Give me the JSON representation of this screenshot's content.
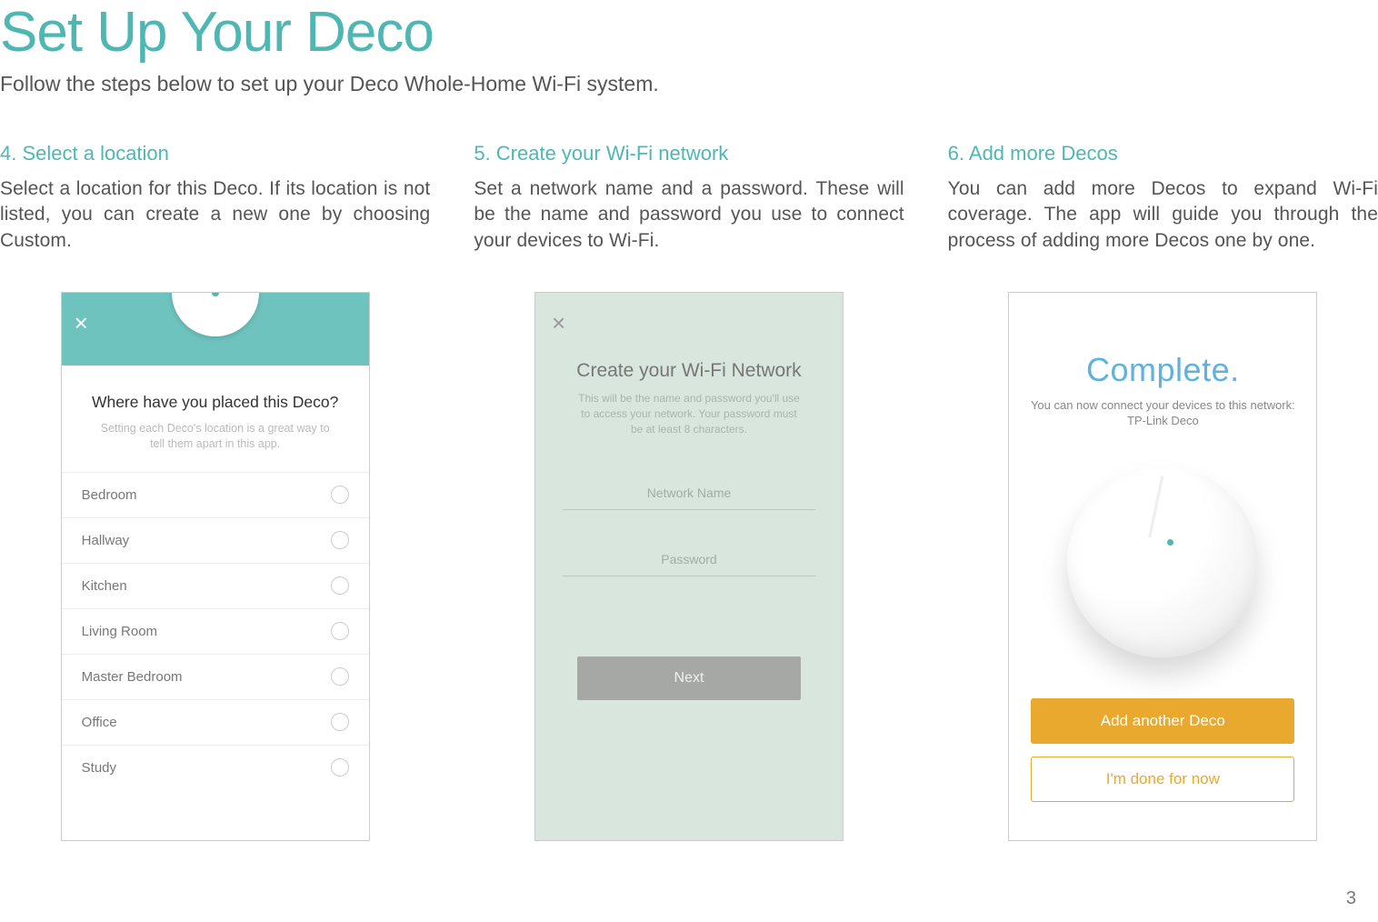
{
  "page": {
    "title": "Set Up Your Deco",
    "subtitle": "Follow the steps below to set up your Deco Whole-Home Wi-Fi system.",
    "number": "3"
  },
  "steps": [
    {
      "heading": "4. Select a location",
      "body": "Select a location for this Deco. If its location is not listed, you can create a new one by choosing Custom."
    },
    {
      "heading": "5. Create your Wi-Fi network",
      "body": "Set a network name and a password. These will be the name and password you use to connect your devices to Wi-Fi."
    },
    {
      "heading": "6. Add more Decos",
      "body": "You can add more Decos to expand Wi-Fi coverage. The app will guide you through the process of adding more Decos one by one."
    }
  ],
  "phone1": {
    "heading": "Where have you placed this Deco?",
    "sub": "Setting each Deco's location is a great way to tell them apart in this app.",
    "items": [
      "Bedroom",
      "Hallway",
      "Kitchen",
      "Living Room",
      "Master Bedroom",
      "Office",
      "Study"
    ]
  },
  "phone2": {
    "heading": "Create your Wi-Fi Network",
    "sub": "This will be the name and password you'll use to access your network. Your password must be at least 8 characters.",
    "network_placeholder": "Network Name",
    "password_placeholder": "Password",
    "next": "Next"
  },
  "phone3": {
    "heading": "Complete.",
    "sub": "You can now connect your devices to this network:",
    "network": "TP-Link Deco",
    "add": "Add another Deco",
    "done": "I'm done for now"
  }
}
